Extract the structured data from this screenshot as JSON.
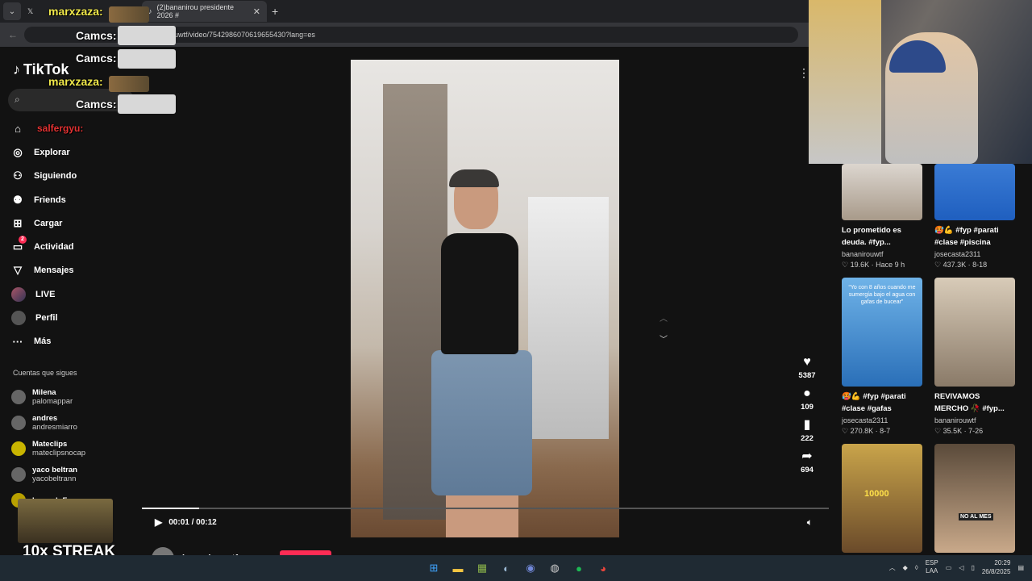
{
  "browser": {
    "tab_active_title": "(2)bananirou presidente 2026 #",
    "url_fragment": "uwtf/video/7542986070619655430?lang=es"
  },
  "overlay": {
    "chat_users": [
      "marxzaza:",
      "Camcs:",
      "Camcs:",
      "marxzaza:",
      "Camcs:",
      "salfergyu:"
    ],
    "streak": "10x STREAK"
  },
  "tiktok": {
    "logo": "TikTok",
    "nav": [
      "Explorar",
      "Siguiendo",
      "Friends",
      "Cargar",
      "Actividad",
      "Mensajes",
      "LIVE",
      "Perfil",
      "Más"
    ],
    "activity_badge": "2",
    "following_title": "Cuentas que sigues",
    "following": [
      {
        "name": "Milena",
        "handle": "palomappar"
      },
      {
        "name": "andres",
        "handle": "andresmiarro"
      },
      {
        "name": "Mateclips",
        "handle": "mateclipsnocap"
      },
      {
        "name": "yaco beltran",
        "handle": "yacobeltrann"
      },
      {
        "name": "LucardoFs",
        "handle": ""
      }
    ]
  },
  "player": {
    "time": "00:01 / 00:12",
    "progress_fraction": 0.083,
    "author": "bananirouwtf",
    "likes": "5387",
    "comments": "109",
    "saves": "222",
    "shares": "694"
  },
  "recommended": [
    {
      "caption": "Lo prometido es deuda. #fyp...",
      "user": "bananirouwtf",
      "meta": "♡ 19.6K · Hace 9 h"
    },
    {
      "caption": "🥵💪 #fyp #parati #clase #piscina",
      "user": "josecasta2311",
      "meta": "♡ 437.3K · 8-18"
    },
    {
      "caption": "🥵💪 #fyp #parati #clase #gafas",
      "user": "josecasta2311",
      "meta": "♡ 270.8K · 8-7"
    },
    {
      "caption": "REVIVAMOS MERCHO 🥀 #fyp...",
      "user": "bananirouwtf",
      "meta": "♡ 35.5K · 7-26"
    },
    {
      "caption": "",
      "user": "",
      "meta": ""
    },
    {
      "caption": "",
      "user": "",
      "meta": ""
    }
  ],
  "thumb_texts": [
    "“Yo con 8 años cuando me sumergía bajo el agua con gafas de bucear”",
    "10000",
    "NO AL MES"
  ],
  "taskbar": {
    "lang": "ESP",
    "lang2": "LAA",
    "time": "20:29",
    "date": "26/8/2025"
  },
  "colors": {
    "accent": "#fe2c55",
    "background": "#121212"
  }
}
